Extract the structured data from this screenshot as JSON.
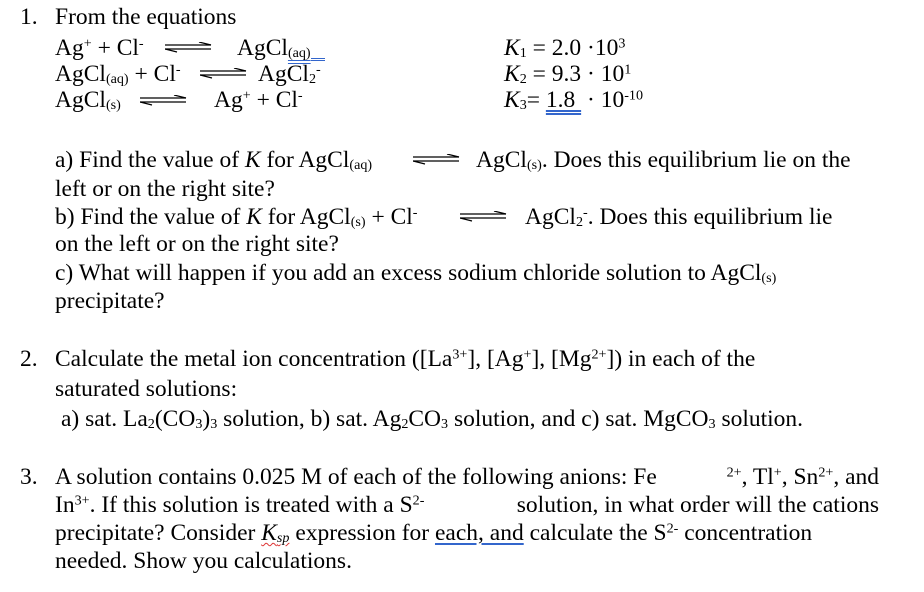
{
  "q1": {
    "number": "1.",
    "intro": "From the equations",
    "equations": [
      {
        "left": [
          "Ag",
          "+",
          " + Cl",
          "-"
        ],
        "right": [
          "AgCl",
          "(aq)"
        ]
      },
      {
        "left": [
          "AgCl",
          "(aq)",
          " + Cl",
          "-"
        ],
        "right": [
          "AgCl",
          "2",
          "-"
        ]
      },
      {
        "left": [
          "AgCl",
          "(s)"
        ],
        "right": [
          "Ag",
          "+",
          " + Cl",
          "-"
        ]
      }
    ],
    "constants": [
      {
        "symbol": "K",
        "sub": "1",
        "eq": " = 2.0 ·10",
        "exp": "3"
      },
      {
        "symbol": "K",
        "sub": "2",
        "eq": " = 9.3 · 10",
        "exp": "1"
      },
      {
        "symbol": "K",
        "sub": "3",
        "eq_pre": "= ",
        "mantissa": "1.8 ",
        "eq": " · 10",
        "exp": "-10"
      }
    ],
    "parts": {
      "a1": "a) Find the value of ",
      "a_k": "K",
      "a2": " for AgCl",
      "a_sub1": "(aq)",
      "a3": "AgCl",
      "a_sub2": "(s)",
      "a4": ". Does this equilibrium lie on the",
      "a5": "left or on the right site?",
      "b1": "b) Find the value of ",
      "b_k": "K",
      "b2": " for AgCl",
      "b_sub1": "(s)",
      "b3": " + Cl",
      "b_sup1": "-",
      "b4": "AgCl",
      "b_sub2": "2",
      "b_sup2": "-",
      "b5": ". Does this equilibrium lie",
      "b6": "on the left or on the right site?",
      "c1": "c) What will happen if you add an excess sodium chloride solution to AgCl",
      "c_sub": "(s)",
      "c2": "precipitate?"
    }
  },
  "q2": {
    "number": "2.",
    "line1_a": "Calculate the metal ion concentration ([La",
    "sup1": "3+",
    "line1_b": "], [Ag",
    "sup2": "+",
    "line1_c": "], [Mg",
    "sup3": "2+",
    "line1_d": "]) in each of the",
    "line2": "saturated solutions:",
    "line3_a": "a) sat. La",
    "l3_sub1": "2",
    "line3_b": "(CO",
    "l3_sub2": "3",
    "line3_c": ")",
    "l3_sub3": "3",
    "line3_d": " solution, b) sat. Ag",
    "l3_sub4": "2",
    "line3_e": "CO",
    "l3_sub5": "3",
    "line3_f": " solution, and c) sat. MgCO",
    "l3_sub6": "3",
    "line3_g": " solution."
  },
  "q3": {
    "number": "3.",
    "l1_a": "A solution contains 0.025 M of each of the following anions: Fe",
    "l1_sup1": "2+",
    "l1_b": ", Tl",
    "l1_sup2": "+",
    "l1_c": ", Sn",
    "l1_sup3": "2+",
    "l1_d": ", and",
    "l2_a": "In",
    "l2_sup1": "3+",
    "l2_b": ". If this solution is treated with a S",
    "l2_sup2": "2-",
    "l2_c": " solution, in what order will the cations",
    "l3_a": "precipitate? Consider ",
    "l3_k": "K",
    "l3_ksub": "sp",
    "l3_b": " expression for ",
    "l3_u": "each, and",
    "l3_c": " calculate the S",
    "l3_sup": "2-",
    "l3_d": " concentration",
    "l4": "needed. Show you calculations."
  }
}
